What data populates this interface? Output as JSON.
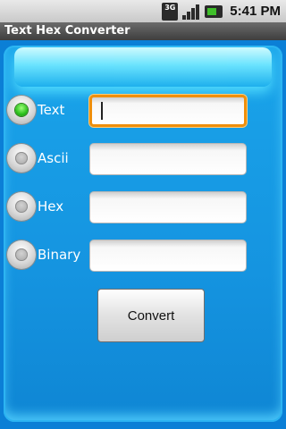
{
  "status_bar": {
    "network_label": "3G",
    "time": "5:41 PM",
    "icons": [
      "network-3g-icon",
      "signal-icon",
      "battery-icon"
    ]
  },
  "app": {
    "title": "Text Hex Converter"
  },
  "form": {
    "options": [
      {
        "label": "Text",
        "checked": true,
        "value": ""
      },
      {
        "label": "Ascii",
        "checked": false,
        "value": ""
      },
      {
        "label": "Hex",
        "checked": false,
        "value": ""
      },
      {
        "label": "Binary",
        "checked": false,
        "value": ""
      }
    ],
    "convert_label": "Convert"
  },
  "colors": {
    "background": "#0b7fd6",
    "panel": "#1594e0",
    "focus": "#f08f0b",
    "radio_selected": "#2cbf1c"
  }
}
